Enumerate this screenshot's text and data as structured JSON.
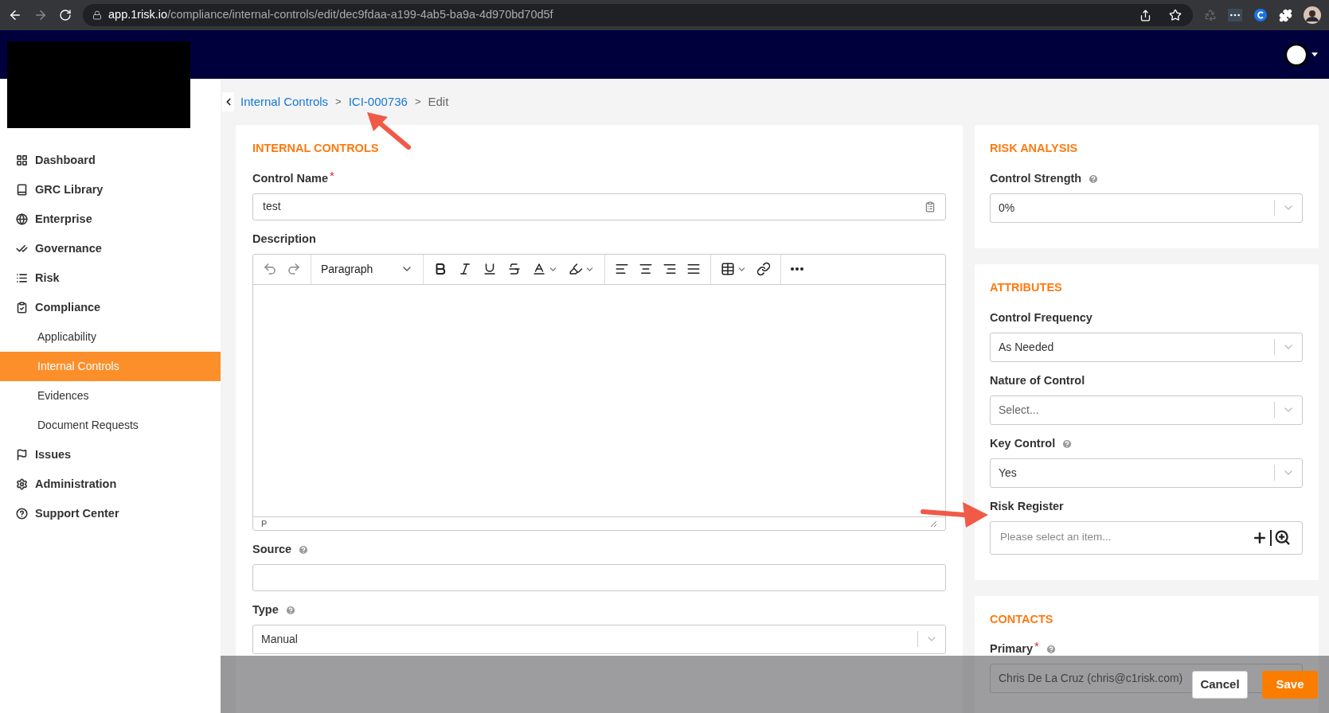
{
  "browser": {
    "url_host": "app.1risk.io",
    "url_path": "/compliance/internal-controls/edit/dec9fdaa-a199-4ab5-ba9a-4d970bd70d5f"
  },
  "sidebar": {
    "items": [
      {
        "label": "Dashboard",
        "selected": false
      },
      {
        "label": "GRC Library",
        "selected": false
      },
      {
        "label": "Enterprise",
        "selected": false
      },
      {
        "label": "Governance",
        "selected": false
      },
      {
        "label": "Risk",
        "selected": false
      },
      {
        "label": "Compliance",
        "selected": false,
        "children": [
          {
            "label": "Applicability",
            "selected": false
          },
          {
            "label": "Internal Controls",
            "selected": true
          },
          {
            "label": "Evidences",
            "selected": false
          },
          {
            "label": "Document Requests",
            "selected": false
          }
        ]
      },
      {
        "label": "Issues",
        "selected": false
      },
      {
        "label": "Administration",
        "selected": false
      },
      {
        "label": "Support Center",
        "selected": false
      }
    ]
  },
  "breadcrumb": [
    {
      "label": "Internal Controls",
      "kind": "link"
    },
    {
      "label": ">",
      "kind": "separator"
    },
    {
      "label": "ICI-000736",
      "kind": "link"
    },
    {
      "label": ">",
      "kind": "separator"
    },
    {
      "label": "Edit",
      "kind": "current"
    }
  ],
  "main_card": {
    "title": "INTERNAL CONTROLS",
    "fields": [
      {
        "label": "Control Name",
        "kind": "text",
        "value": "test",
        "required_mark": "*",
        "help": false,
        "field_icon": true
      },
      {
        "label": "Description",
        "kind": "editor",
        "help": false,
        "block_format": "Paragraph",
        "path": "P"
      },
      {
        "label": "Source",
        "kind": "text",
        "help": true,
        "field_icon": false
      },
      {
        "label": "Type",
        "kind": "select",
        "value": "Manual",
        "help": true
      }
    ]
  },
  "side_cards": [
    {
      "title": "RISK ANALYSIS",
      "fields": [
        {
          "label": "Control Strength",
          "kind": "select",
          "value": "0%",
          "help": true
        }
      ]
    },
    {
      "title": "ATTRIBUTES",
      "fields": [
        {
          "label": "Control Frequency",
          "kind": "select",
          "value": "As Needed",
          "help": false
        },
        {
          "label": "Nature of Control",
          "kind": "select",
          "placeholder": "Select...",
          "help": false
        },
        {
          "label": "Key Control",
          "kind": "select",
          "value": "Yes",
          "help": true
        },
        {
          "label": "Risk Register",
          "kind": "lookup",
          "placeholder": "Please select an item...",
          "help": false
        }
      ]
    },
    {
      "title": "CONTACTS",
      "fields": [
        {
          "label": "Primary",
          "kind": "select",
          "value": "Chris De La Cruz (chris@c1risk.com)",
          "required_mark": "*",
          "help": true
        }
      ]
    }
  ],
  "footer": {
    "buttons": [
      {
        "label": "Cancel",
        "kind": "secondary"
      },
      {
        "label": "Save",
        "kind": "primary"
      }
    ]
  }
}
